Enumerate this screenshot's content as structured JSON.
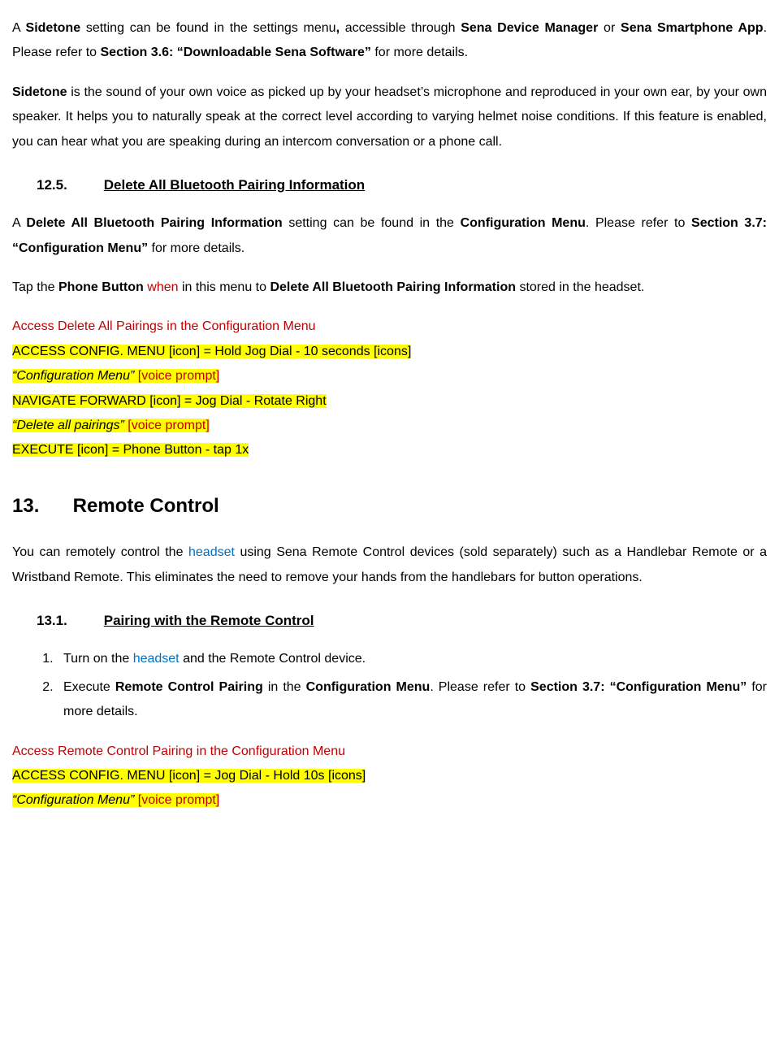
{
  "p1": {
    "t1": "A ",
    "b1": "Sidetone",
    "t2": " setting can be found in the settings menu",
    "b2": ",",
    "t3": " accessible through ",
    "b3": "Sena Device Manager",
    "t4": " or ",
    "b4": "Sena Smartphone App",
    "t5": ". Please refer to ",
    "b5": "Section 3.6: “Downloadable Sena Software”",
    "t6": " for more details."
  },
  "p2": {
    "b1": "Sidetone",
    "t1": " is the sound of your own voice as picked up by your headset’s microphone and reproduced in your own ear, by your own speaker. It helps you to naturally speak at the correct level according to varying helmet noise conditions. If this feature is enabled, you can hear what you are speaking during an intercom conversation or a phone call."
  },
  "s12_5": {
    "num": "12.5.",
    "title": "Delete All Bluetooth Pairing Information"
  },
  "p3": {
    "t1": "A ",
    "b1": "Delete All Bluetooth Pairing Information",
    "t2": " setting can be found in the ",
    "b2": "Configuration Menu",
    "t3": ". Please refer to ",
    "b3": "Section 3.7: “Configuration Menu”",
    "t4": " for more details."
  },
  "p4": {
    "t1": "Tap the ",
    "b1": "Phone Button",
    "t2": " ",
    "r1": "when",
    "t3": " in this menu to ",
    "b2": "Delete All Bluetooth Pairing Information",
    "t4": " stored in the headset."
  },
  "instr1": {
    "title": "Access Delete All Pairings in the Configuration Menu",
    "l1": "ACCESS CONFIG. MENU [icon] = Hold Jog Dial  - 10 seconds [icons]",
    "l2a": "“Configuration Menu” ",
    "l2b": "[voice prompt]",
    "l3": "NAVIGATE FORWARD [icon] = Jog Dial - Rotate Right",
    "l4a": "“Delete all pairings” ",
    "l4b": "[voice prompt]",
    "l5": "EXECUTE [icon] = Phone Button - tap 1x"
  },
  "s13": {
    "num": "13.",
    "title": "Remote Control"
  },
  "p5": {
    "t1": "You can remotely control the ",
    "bl1": "headset",
    "t2": " using Sena Remote Control devices (sold separately) such as a Handlebar Remote or a Wristband Remote. This eliminates the need to remove your hands from the handlebars for button operations."
  },
  "s13_1": {
    "num": "13.1.",
    "title": "Pairing with the Remote Control"
  },
  "step1": {
    "t1": "Turn on the ",
    "bl1": "headset",
    "t2": " and the Remote Control device."
  },
  "step2": {
    "t1": "Execute ",
    "b1": "Remote Control Pairing",
    "t2": " in the ",
    "b2": "Configuration Menu",
    "t3": ". Please refer to ",
    "b3": "Section 3.7: “Configuration Menu”",
    "t4": " for more details."
  },
  "instr2": {
    "title": "Access Remote Control Pairing in the Configuration Menu",
    "l1": "ACCESS CONFIG. MENU [icon] = Jog Dial  - Hold 10s [icons]",
    "l2a": "“Configuration Menu” ",
    "l2b": "[voice prompt]"
  }
}
